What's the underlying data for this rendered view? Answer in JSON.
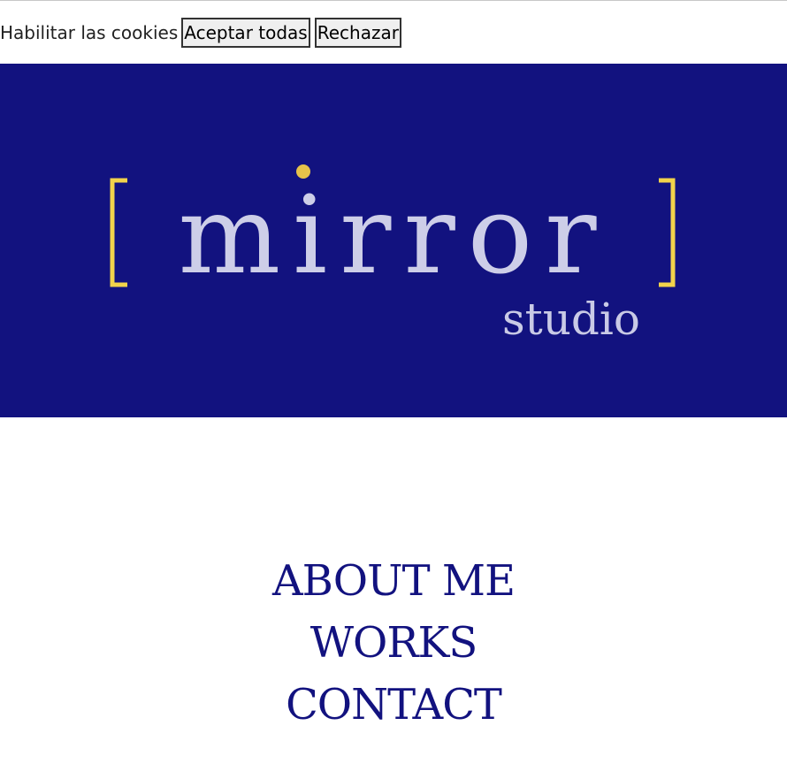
{
  "cookie_bar": {
    "label": "Habilitar las cookies",
    "accept_label": "Aceptar todas",
    "reject_label": "Rechazar"
  },
  "hero": {
    "logo_word": "mirror",
    "logo_sub": "studio",
    "colors": {
      "background": "#12127f",
      "bracket": "#f2d34b",
      "dot": "#e6c24a",
      "letters": "#d8d9ee"
    }
  },
  "nav": {
    "items": [
      {
        "label": "ABOUT ME"
      },
      {
        "label": "WORKS"
      },
      {
        "label": "CONTACT"
      }
    ]
  },
  "colors": {
    "accent": "#12127f"
  }
}
